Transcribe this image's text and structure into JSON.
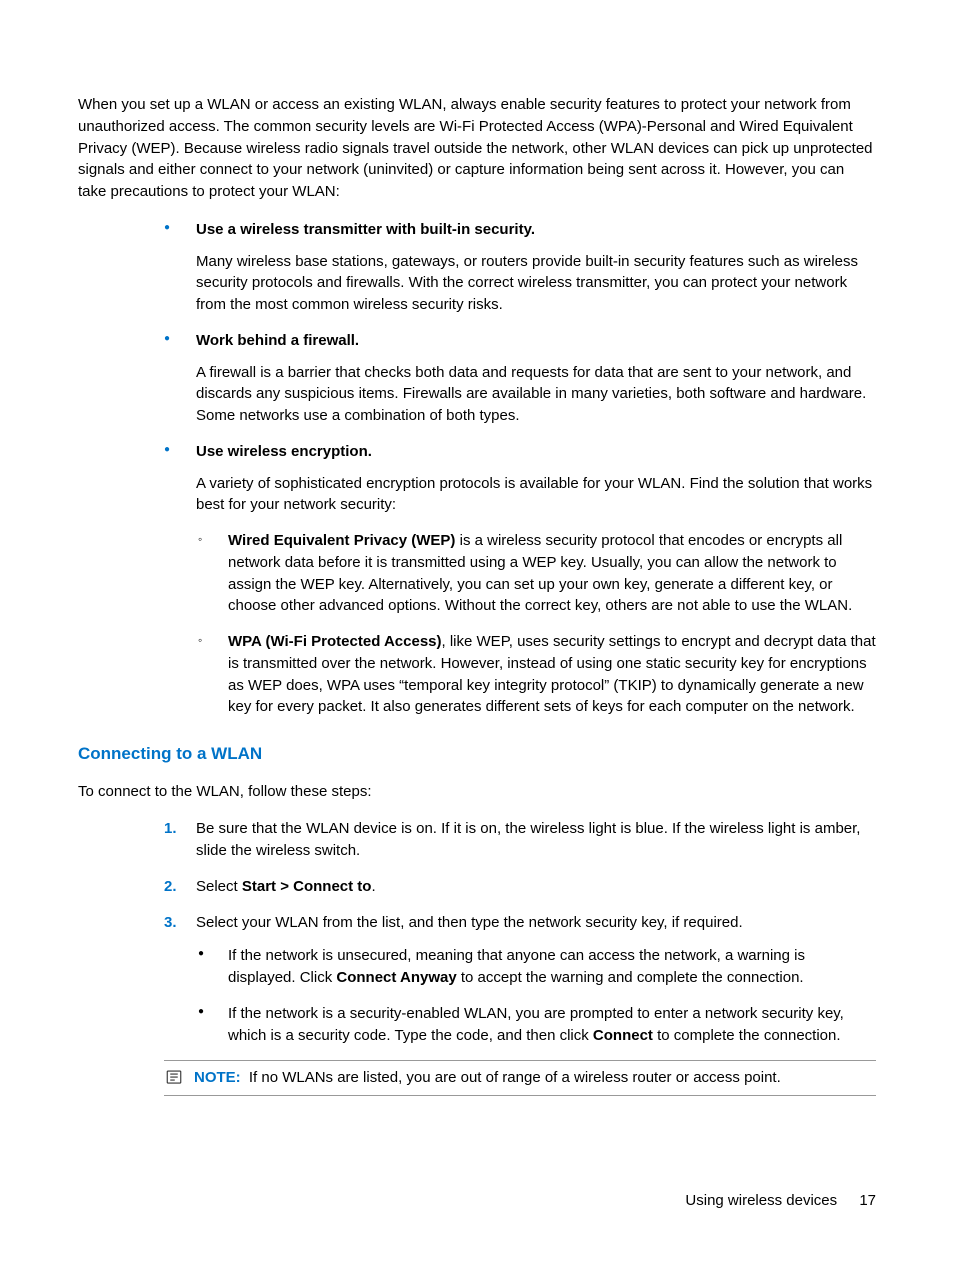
{
  "intro": "When you set up a WLAN or access an existing WLAN, always enable security features to protect your network from unauthorized access. The common security levels are Wi-Fi Protected Access (WPA)-Personal and Wired Equivalent Privacy (WEP). Because wireless radio signals travel outside the network, other WLAN devices can pick up unprotected signals and either connect to your network (uninvited) or capture information being sent across it. However, you can take precautions to protect your WLAN:",
  "bullets": [
    {
      "head": "Use a wireless transmitter with built-in security.",
      "body": "Many wireless base stations, gateways, or routers provide built-in security features such as wireless security protocols and firewalls. With the correct wireless transmitter, you can protect your network from the most common wireless security risks."
    },
    {
      "head": "Work behind a firewall.",
      "body": "A firewall is a barrier that checks both data and requests for data that are sent to your network, and discards any suspicious items. Firewalls are available in many varieties, both software and hardware. Some networks use a combination of both types."
    },
    {
      "head": "Use wireless encryption.",
      "body": "A variety of sophisticated encryption protocols is available for your WLAN. Find the solution that works best for your network security:",
      "sub": [
        {
          "lead": "Wired Equivalent Privacy (WEP)",
          "rest": " is a wireless security protocol that encodes or encrypts all network data before it is transmitted using a WEP key. Usually, you can allow the network to assign the WEP key. Alternatively, you can set up your own key, generate a different key, or choose other advanced options. Without the correct key, others are not able to use the WLAN."
        },
        {
          "lead": "WPA (Wi-Fi Protected Access)",
          "rest": ", like WEP, uses security settings to encrypt and decrypt data that is transmitted over the network. However, instead of using one static security key for encryptions as WEP does, WPA uses “temporal key integrity protocol” (TKIP) to dynamically generate a new key for every packet. It also generates different sets of keys for each computer on the network."
        }
      ]
    }
  ],
  "h2": "Connecting to a WLAN",
  "steps_intro": "To connect to the WLAN, follow these steps:",
  "steps": [
    {
      "text": "Be sure that the WLAN device is on. If it is on, the wireless light is blue. If the wireless light is amber, slide the wireless switch."
    },
    {
      "pre": "Select ",
      "bold": "Start > Connect to",
      "post": "."
    },
    {
      "text": "Select your WLAN from the list, and then type the network security key, if required.",
      "inner": [
        {
          "pre": "If the network is unsecured, meaning that anyone can access the network, a warning is displayed. Click ",
          "bold": "Connect Anyway",
          "post": " to accept the warning and complete the connection."
        },
        {
          "pre": "If the network is a security-enabled WLAN, you are prompted to enter a network security key, which is a security code. Type the code, and then click ",
          "bold": "Connect",
          "post": " to complete the connection."
        }
      ]
    }
  ],
  "note": {
    "label": "NOTE:",
    "text": "If no WLANs are listed, you are out of range of a wireless router or access point."
  },
  "footer": {
    "section": "Using wireless devices",
    "page": "17"
  }
}
